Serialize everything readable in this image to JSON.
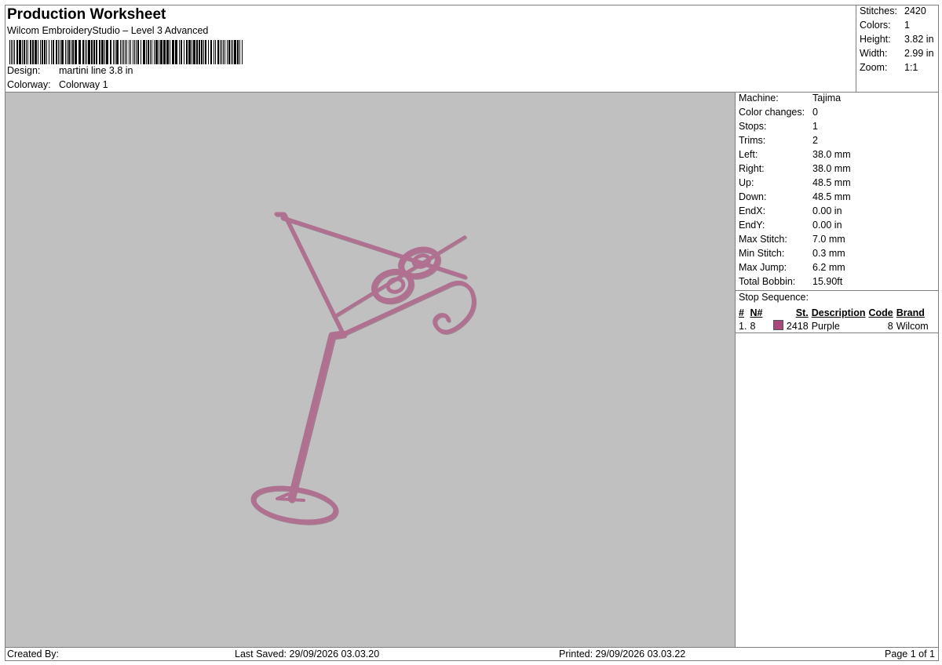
{
  "header": {
    "title": "Production Worksheet",
    "software": "Wilcom EmbroideryStudio – Level 3 Advanced",
    "design_label": "Design:",
    "design_value": "martini line 3.8 in",
    "colorway_label": "Colorway:",
    "colorway_value": "Colorway 1"
  },
  "stats": [
    {
      "label": "Stitches:",
      "value": "2420"
    },
    {
      "label": "Colors:",
      "value": "1"
    },
    {
      "label": "Height:",
      "value": "3.82 in"
    },
    {
      "label": "Width:",
      "value": "2.99 in"
    },
    {
      "label": "Zoom:",
      "value": "1:1"
    }
  ],
  "machine_info": [
    {
      "label": "Machine:",
      "value": "Tajima"
    },
    {
      "label": "Color changes:",
      "value": "0"
    },
    {
      "label": "Stops:",
      "value": "1"
    },
    {
      "label": "Trims:",
      "value": "2"
    },
    {
      "label": "Left:",
      "value": "38.0 mm"
    },
    {
      "label": "Right:",
      "value": "38.0 mm"
    },
    {
      "label": "Up:",
      "value": "48.5 mm"
    },
    {
      "label": "Down:",
      "value": "48.5 mm"
    },
    {
      "label": "EndX:",
      "value": "0.00 in"
    },
    {
      "label": "EndY:",
      "value": "0.00 in"
    },
    {
      "label": "Max Stitch:",
      "value": "7.0 mm"
    },
    {
      "label": "Min Stitch:",
      "value": "0.3 mm"
    },
    {
      "label": "Max Jump:",
      "value": "6.2 mm"
    },
    {
      "label": "Total Bobbin:",
      "value": "15.90ft"
    }
  ],
  "stop_sequence": {
    "title": "Stop Sequence:",
    "columns": [
      "#",
      "N#",
      "St.",
      "Description",
      "Code",
      "Brand"
    ],
    "rows": [
      {
        "index": "1.",
        "needle": "8",
        "color": "#a8487a",
        "stitches": "2418",
        "description": "Purple",
        "code": "8",
        "brand": "Wilcom"
      }
    ]
  },
  "design": {
    "icon": "martini-glass-embroidery",
    "thread_color": "#b07090",
    "thread_shadow": "#8a4d6c"
  },
  "footer": {
    "created_by": "Created By:",
    "last_saved": "Last Saved: 29/09/2026 03.03.20",
    "printed": "Printed: 29/09/2026 03.03.22",
    "page": "Page 1 of 1"
  }
}
